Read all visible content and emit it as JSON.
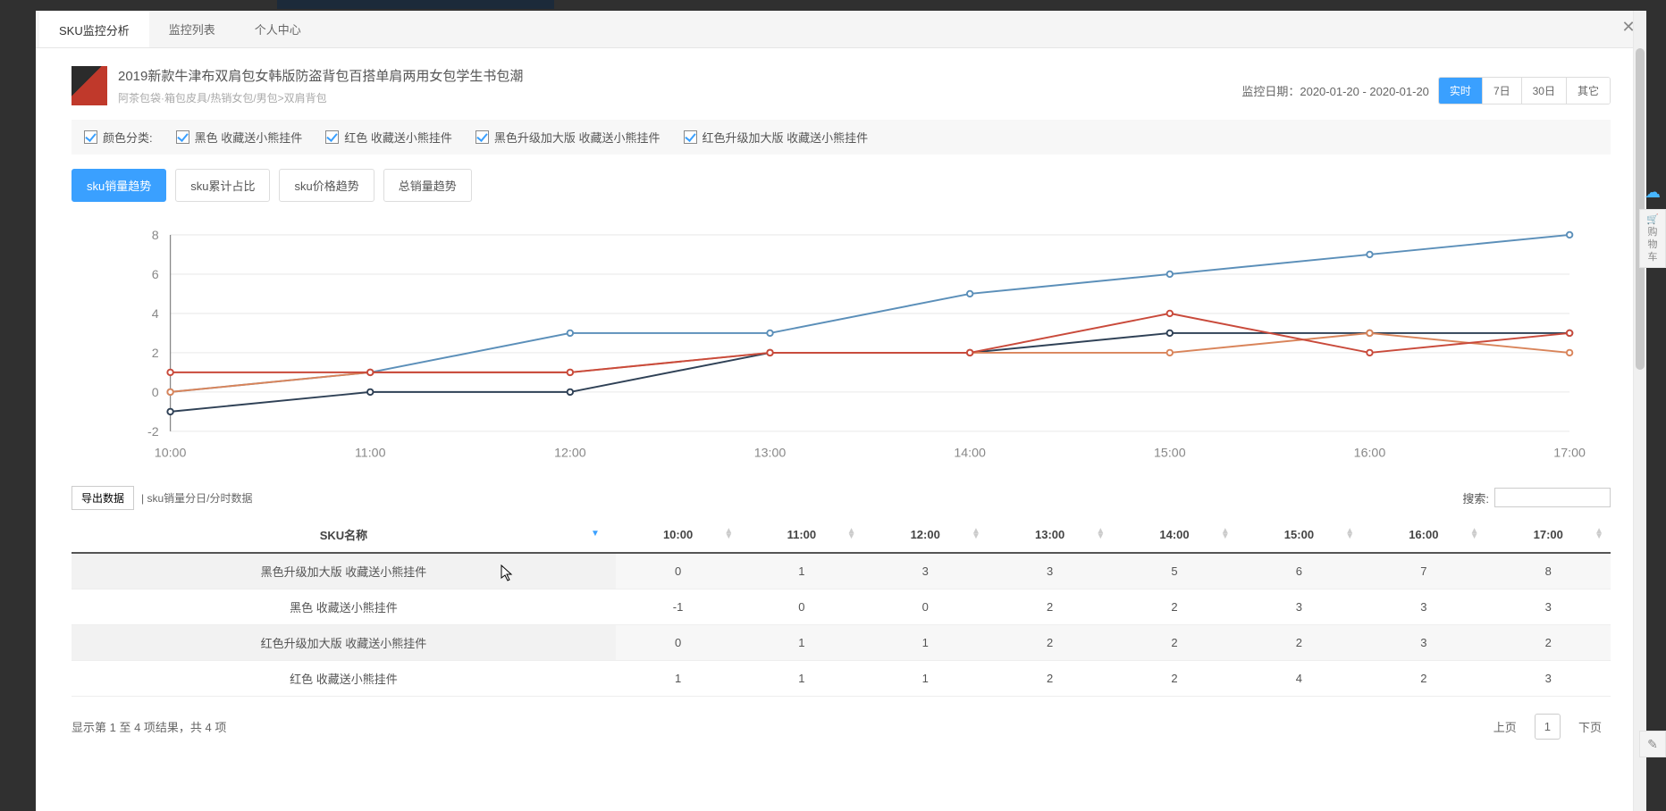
{
  "backdrop": {
    "price_fragment": "",
    "right_fragment": ""
  },
  "tabs": [
    {
      "label": "SKU监控分析",
      "active": true
    },
    {
      "label": "监控列表",
      "active": false
    },
    {
      "label": "个人中心",
      "active": false
    }
  ],
  "product": {
    "title": "2019新款牛津布双肩包女韩版防盗背包百搭单肩两用女包学生书包潮",
    "breadcrumb": "阿茶包袋·箱包皮具/热销女包/男包>双肩背包"
  },
  "date_range": {
    "label": "监控日期：",
    "value": "2020-01-20 - 2020-01-20",
    "buttons": [
      {
        "label": "实时",
        "active": true
      },
      {
        "label": "7日",
        "active": false
      },
      {
        "label": "30日",
        "active": false
      },
      {
        "label": "其它",
        "active": false
      }
    ]
  },
  "filters": {
    "group_label": "颜色分类:",
    "items": [
      "黑色 收藏送小熊挂件",
      "红色 收藏送小熊挂件",
      "黑色升级加大版 收藏送小熊挂件",
      "红色升级加大版 收藏送小熊挂件"
    ]
  },
  "metric_tabs": [
    {
      "label": "sku销量趋势",
      "active": true
    },
    {
      "label": "sku累计占比",
      "active": false
    },
    {
      "label": "sku价格趋势",
      "active": false
    },
    {
      "label": "总销量趋势",
      "active": false
    }
  ],
  "chart_data": {
    "type": "line",
    "xlabel": "",
    "ylabel": "",
    "ylim": [
      -2,
      8
    ],
    "y_ticks": [
      -2,
      0,
      2,
      4,
      6,
      8
    ],
    "categories": [
      "10:00",
      "11:00",
      "12:00",
      "13:00",
      "14:00",
      "15:00",
      "16:00",
      "17:00"
    ],
    "series": [
      {
        "name": "黑色升级加大版 收藏送小熊挂件",
        "color": "#5b8fb9",
        "values": [
          0,
          1,
          3,
          3,
          5,
          6,
          7,
          8
        ]
      },
      {
        "name": "黑色 收藏送小熊挂件",
        "color": "#2f4156",
        "values": [
          -1,
          0,
          0,
          2,
          2,
          3,
          3,
          3
        ]
      },
      {
        "name": "红色升级加大版 收藏送小熊挂件",
        "color": "#d9845a",
        "values": [
          0,
          1,
          1,
          2,
          2,
          2,
          3,
          2
        ]
      },
      {
        "name": "红色 收藏送小熊挂件",
        "color": "#c94a3b",
        "values": [
          1,
          1,
          1,
          2,
          2,
          4,
          2,
          3
        ]
      }
    ]
  },
  "table_toolbar": {
    "export": "导出数据",
    "title": "| sku销量分日/分时数据",
    "search_label": "搜索:",
    "search_value": ""
  },
  "table": {
    "columns": [
      "SKU名称",
      "10:00",
      "11:00",
      "12:00",
      "13:00",
      "14:00",
      "15:00",
      "16:00",
      "17:00"
    ],
    "rows": [
      {
        "name": "黑色升级加大版 收藏送小熊挂件",
        "cells": [
          "0",
          "1",
          "3",
          "3",
          "5",
          "6",
          "7",
          "8"
        ]
      },
      {
        "name": "黑色 收藏送小熊挂件",
        "cells": [
          "-1",
          "0",
          "0",
          "2",
          "2",
          "3",
          "3",
          "3"
        ]
      },
      {
        "name": "红色升级加大版 收藏送小熊挂件",
        "cells": [
          "0",
          "1",
          "1",
          "2",
          "2",
          "2",
          "3",
          "2"
        ]
      },
      {
        "name": "红色 收藏送小熊挂件",
        "cells": [
          "1",
          "1",
          "1",
          "2",
          "2",
          "4",
          "2",
          "3"
        ]
      }
    ]
  },
  "footer": {
    "info": "显示第 1 至 4 项结果，共 4 项",
    "prev": "上页",
    "page": "1",
    "next": "下页"
  },
  "side": {
    "cart_line1": "购",
    "cart_line2": "物",
    "cart_line3": "车"
  }
}
